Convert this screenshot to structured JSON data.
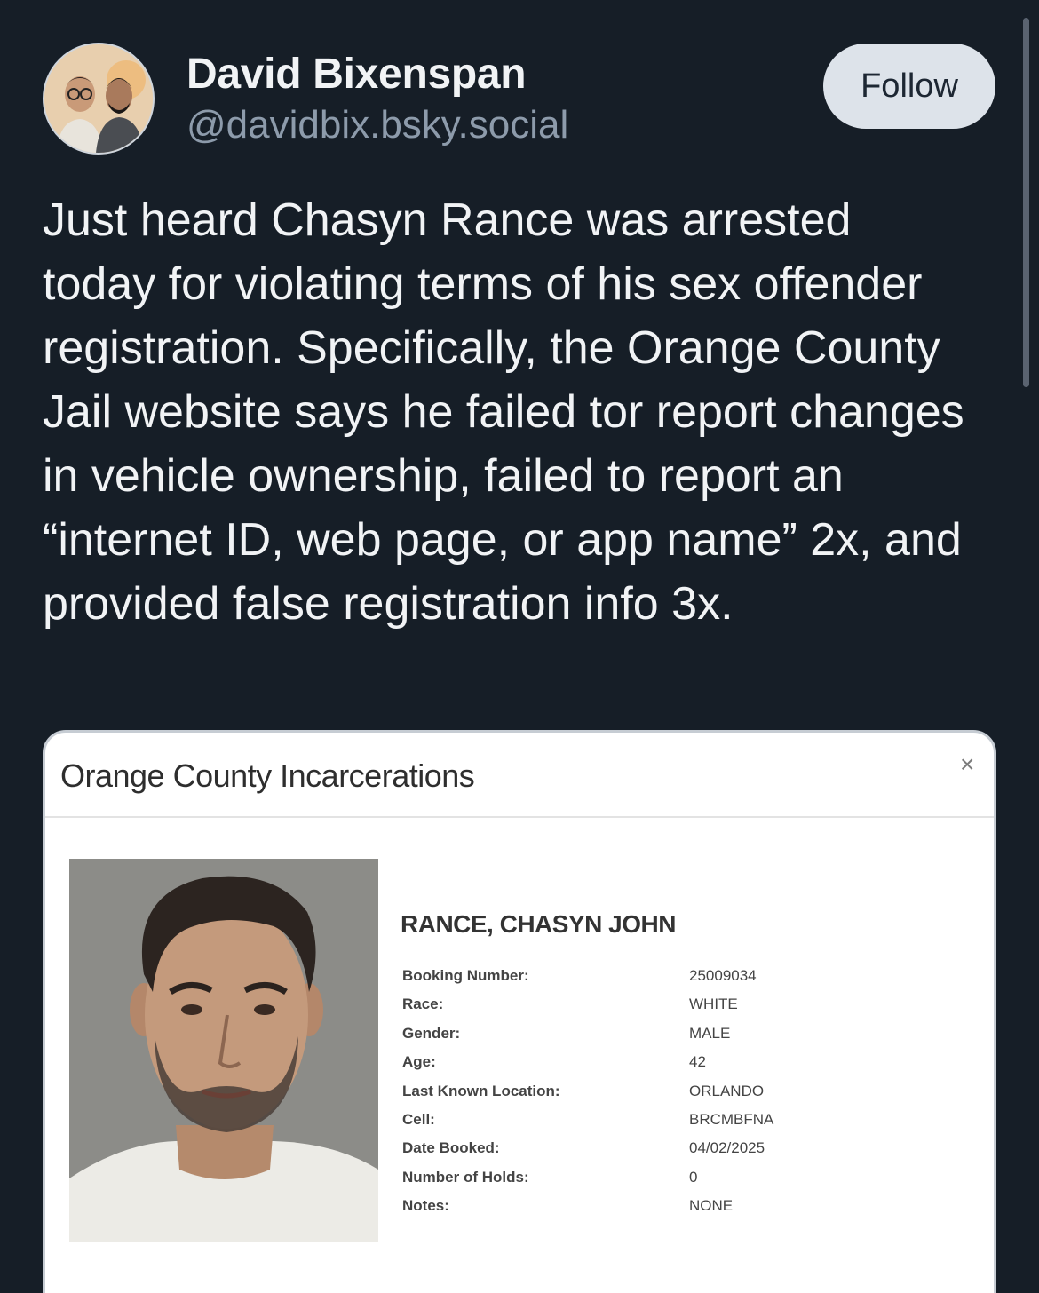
{
  "author": {
    "display_name": "David Bixenspan",
    "handle": "@davidbix.bsky.social"
  },
  "follow_label": "Follow",
  "post_text": "Just heard Chasyn Rance was arrested today for violating terms of his sex offender registration. Specifically, the Orange County Jail website says he failed tor report changes in vehicle ownership, failed to report an “internet ID, web page, or app name” 2x, and provided false registration info 3x.",
  "embed": {
    "title": "Orange County Incarcerations",
    "close_symbol": "×",
    "inmate_name": "RANCE, CHASYN JOHN",
    "details": [
      {
        "label": "Booking Number:",
        "value": "25009034"
      },
      {
        "label": "Race:",
        "value": "WHITE"
      },
      {
        "label": "Gender:",
        "value": "MALE"
      },
      {
        "label": "Age:",
        "value": "42"
      },
      {
        "label": "Last Known Location:",
        "value": "ORLANDO"
      },
      {
        "label": "Cell:",
        "value": "BRCMBFNA"
      },
      {
        "label": "Date Booked:",
        "value": "04/02/2025"
      },
      {
        "label": "Number of Holds:",
        "value": "0"
      },
      {
        "label": "Notes:",
        "value": "NONE"
      }
    ]
  },
  "colors": {
    "background": "#161e27",
    "follow_button_bg": "#dde3ea",
    "handle_text": "#8d9bab"
  }
}
